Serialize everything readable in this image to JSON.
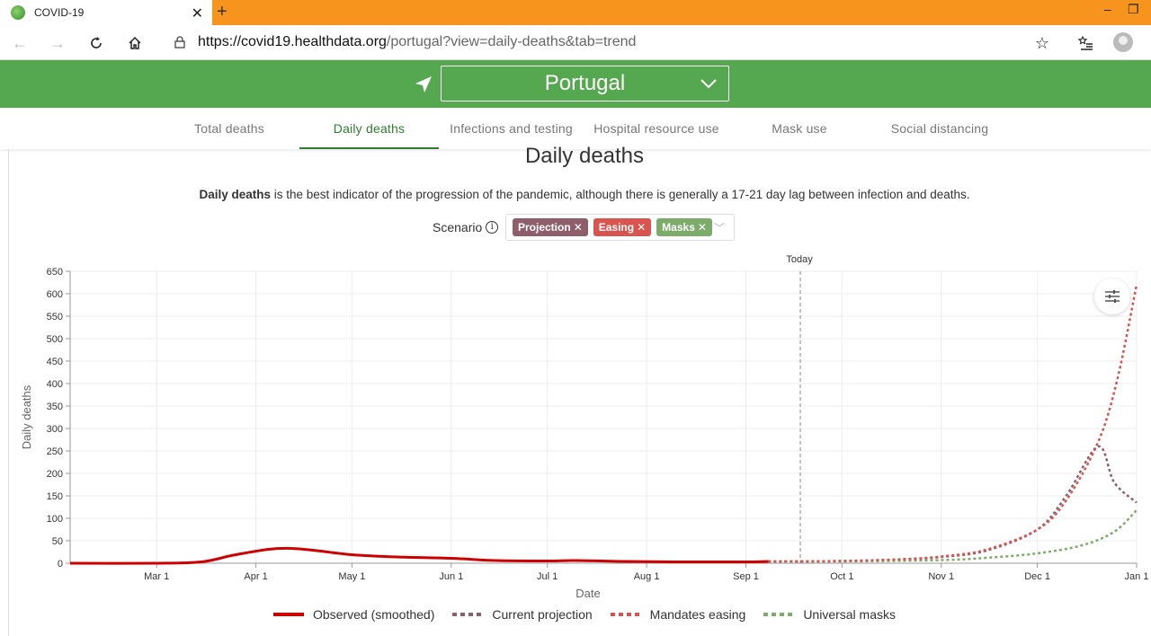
{
  "browser": {
    "tab_title": "COVID-19",
    "url_host": "https://covid19.healthdata.org",
    "url_path": "/portugal?view=daily-deaths&tab=trend"
  },
  "header": {
    "country": "Portugal"
  },
  "subtabs": [
    {
      "label": "Total deaths",
      "active": false
    },
    {
      "label": "Daily deaths",
      "active": true
    },
    {
      "label": "Infections and testing",
      "active": false
    },
    {
      "label": "Hospital resource use",
      "active": false
    },
    {
      "label": "Mask use",
      "active": false
    },
    {
      "label": "Social distancing",
      "active": false
    }
  ],
  "main": {
    "title": "Daily deaths",
    "desc_bold": "Daily deaths",
    "desc_rest": " is the best indicator of the progression of the pandemic, although there is generally a 17-21 day lag between infection and deaths.",
    "scenario_label": "Scenario",
    "scenario_chips": [
      {
        "label": "Projection",
        "color": "#8e5f6a"
      },
      {
        "label": "Easing",
        "color": "#d9534f"
      },
      {
        "label": "Masks",
        "color": "#7cab6a"
      }
    ]
  },
  "chart_data": {
    "type": "line",
    "xlabel": "Date",
    "ylabel": "Daily deaths",
    "ylim": [
      0,
      650
    ],
    "yticks": [
      0,
      50,
      100,
      150,
      200,
      250,
      300,
      350,
      400,
      450,
      500,
      550,
      600,
      650
    ],
    "xticks": [
      "Mar 1",
      "Apr 1",
      "May 1",
      "Jun 1",
      "Jul 1",
      "Aug 1",
      "Sep 1",
      "Oct 1",
      "Nov 1",
      "Dec 1",
      "Jan 1"
    ],
    "today_label": "Today",
    "today_date": "2020-09-18",
    "xlim": [
      "2020-02-03",
      "2021-01-01"
    ],
    "grid": true,
    "series": [
      {
        "name": "Observed (smoothed)",
        "color": "#cc0000",
        "dash": "solid",
        "points": [
          [
            "2020-02-03",
            0
          ],
          [
            "2020-03-01",
            0
          ],
          [
            "2020-03-15",
            3
          ],
          [
            "2020-03-25",
            18
          ],
          [
            "2020-04-05",
            31
          ],
          [
            "2020-04-12",
            33
          ],
          [
            "2020-04-20",
            28
          ],
          [
            "2020-05-01",
            19
          ],
          [
            "2020-05-15",
            14
          ],
          [
            "2020-06-01",
            11
          ],
          [
            "2020-06-15",
            6
          ],
          [
            "2020-07-01",
            5
          ],
          [
            "2020-07-10",
            6
          ],
          [
            "2020-07-25",
            4
          ],
          [
            "2020-08-10",
            3
          ],
          [
            "2020-09-01",
            3
          ],
          [
            "2020-09-08",
            4
          ]
        ]
      },
      {
        "name": "Current projection",
        "color": "#8e5f6a",
        "dash": "dash",
        "points": [
          [
            "2020-09-08",
            4
          ],
          [
            "2020-10-01",
            5
          ],
          [
            "2020-10-20",
            9
          ],
          [
            "2020-11-01",
            14
          ],
          [
            "2020-11-15",
            28
          ],
          [
            "2020-12-01",
            75
          ],
          [
            "2020-12-10",
            150
          ],
          [
            "2020-12-20",
            260
          ],
          [
            "2020-12-25",
            180
          ],
          [
            "2021-01-01",
            135
          ]
        ]
      },
      {
        "name": "Mandates easing",
        "color": "#d9534f",
        "dash": "dash",
        "points": [
          [
            "2020-09-08",
            4
          ],
          [
            "2020-10-01",
            5
          ],
          [
            "2020-10-20",
            9
          ],
          [
            "2020-11-01",
            15
          ],
          [
            "2020-11-15",
            30
          ],
          [
            "2020-12-01",
            75
          ],
          [
            "2020-12-10",
            140
          ],
          [
            "2020-12-20",
            270
          ],
          [
            "2020-12-26",
            410
          ],
          [
            "2021-01-01",
            620
          ]
        ]
      },
      {
        "name": "Universal masks",
        "color": "#7cab6a",
        "dash": "dash",
        "points": [
          [
            "2020-09-08",
            4
          ],
          [
            "2020-10-01",
            4
          ],
          [
            "2020-11-01",
            7
          ],
          [
            "2020-11-15",
            12
          ],
          [
            "2020-12-01",
            22
          ],
          [
            "2020-12-15",
            40
          ],
          [
            "2020-12-25",
            70
          ],
          [
            "2021-01-01",
            118
          ]
        ]
      }
    ]
  }
}
